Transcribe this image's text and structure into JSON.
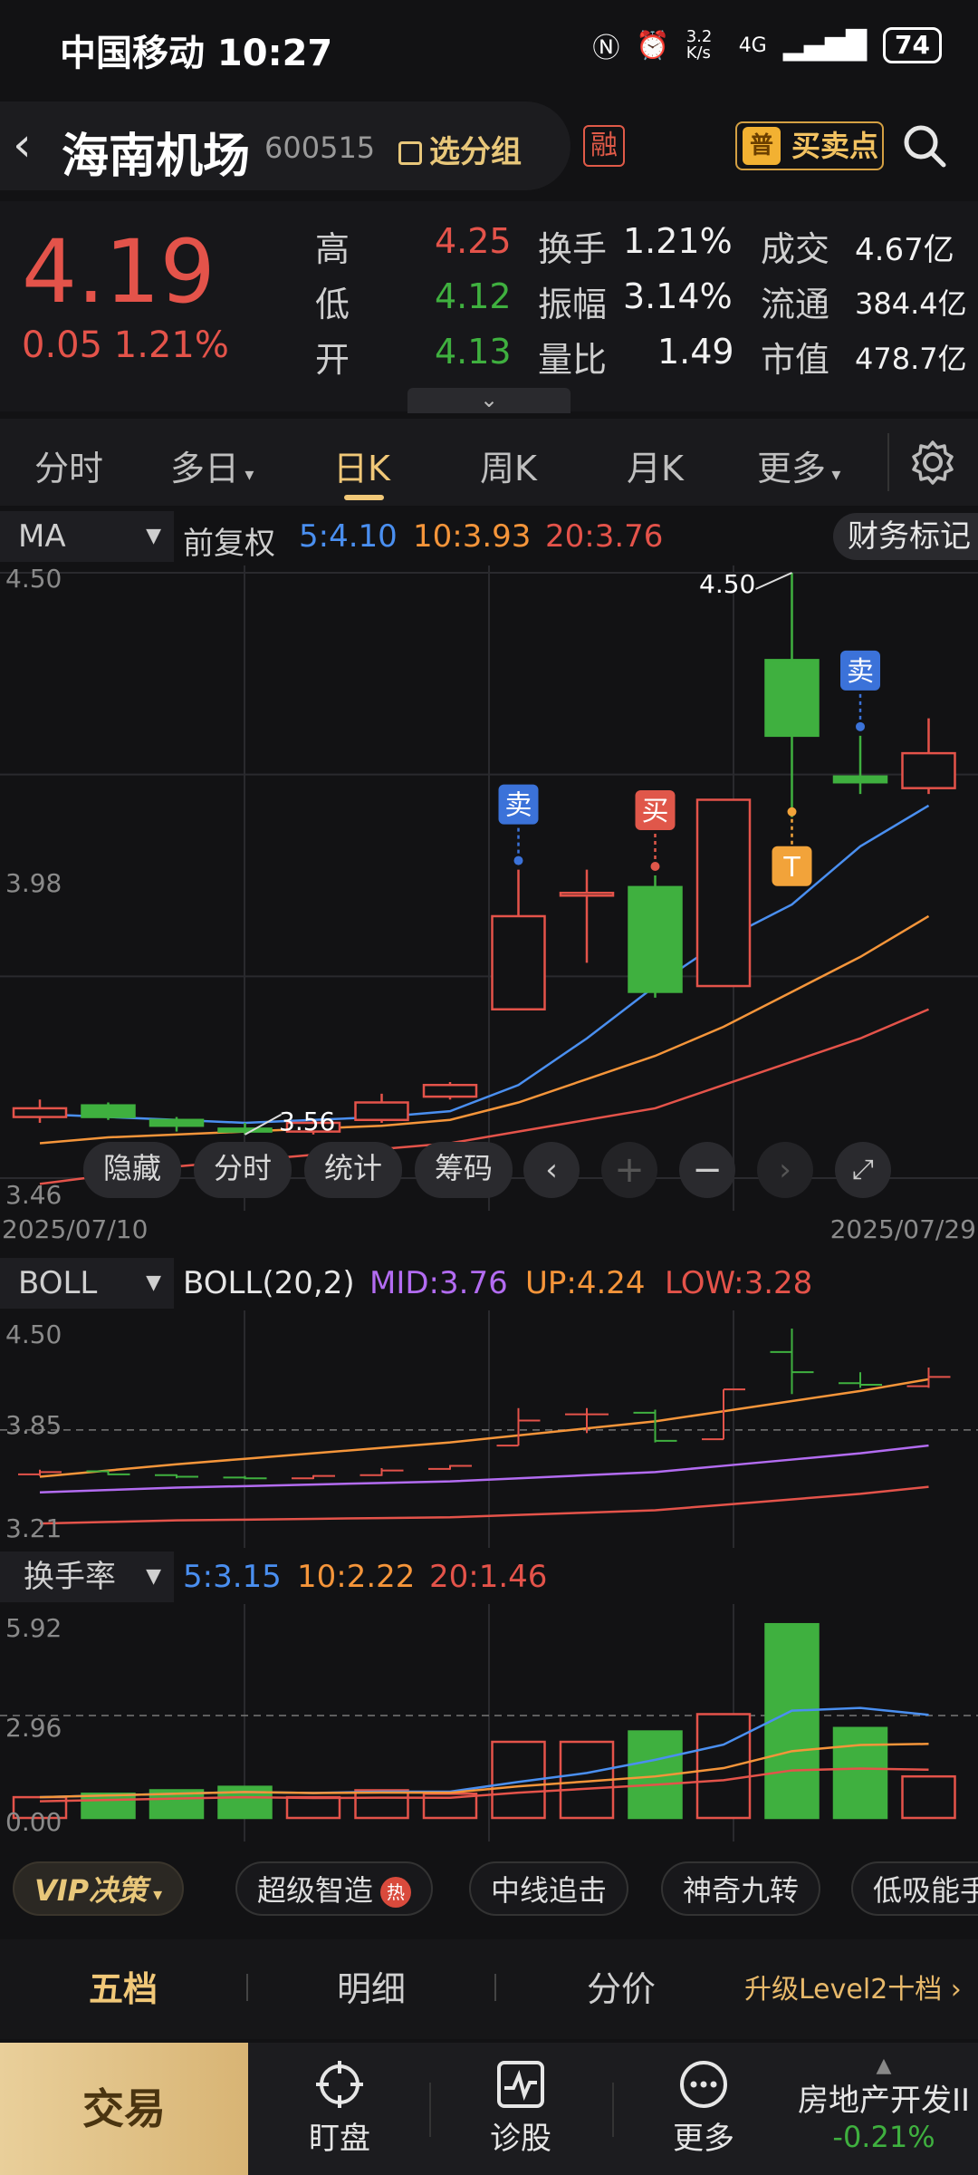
{
  "status": {
    "carrier_time": "中国移动 10:27",
    "speed": "3.2 K/s",
    "network": "4G",
    "battery": "74"
  },
  "header": {
    "back_glyph": "‹",
    "stock_name": "海南机场",
    "stock_code": "600515",
    "group_label": "选分组",
    "margin_badge": "融",
    "buy_sell_label": "买卖点",
    "buy_sell_badge": "普"
  },
  "quote": {
    "price": "4.19",
    "change": "0.05 1.21%",
    "high_label": "高",
    "high": "4.25",
    "low_label": "低",
    "low": "4.12",
    "open_label": "开",
    "open": "4.13",
    "turnover_label": "换手",
    "turnover": "1.21%",
    "amplitude_label": "振幅",
    "amplitude": "3.14%",
    "volume_ratio_label": "量比",
    "volume_ratio": "1.49",
    "deal_label": "成交",
    "deal": "4.67亿",
    "float_label": "流通",
    "float_cap": "384.4亿",
    "mcap_label": "市值",
    "mcap": "478.7亿"
  },
  "tabs": [
    {
      "label": "分时"
    },
    {
      "label": "多日"
    },
    {
      "label": "日K"
    },
    {
      "label": "周K"
    },
    {
      "label": "月K"
    },
    {
      "label": "更多"
    }
  ],
  "ma_bar": {
    "selector": "MA",
    "adjust": "前复权",
    "ma5": "5:4.10",
    "ma10": "10:3.93",
    "ma20": "20:3.76",
    "fin_mark": "财务标记"
  },
  "kchart": {
    "y_top": "4.50",
    "y_mid": "3.98",
    "y_bot": "3.46",
    "high_label": "4.50",
    "low_label": "3.56",
    "date_start": "2025/07/10",
    "date_end": "2025/07/29",
    "tool_hide": "隐藏",
    "tool_fenshi": "分时",
    "tool_stats": "统计",
    "tool_chip": "筹码",
    "sig_sell": "卖",
    "sig_buy": "买",
    "sig_t": "T"
  },
  "boll_bar": {
    "selector": "BOLL",
    "name": "BOLL(20,2)",
    "mid": "MID:3.76",
    "up": "UP:4.24",
    "low": "LOW:3.28",
    "y_top": "4.50",
    "y_mid": "3.85",
    "y_bot": "3.21"
  },
  "turn_bar": {
    "selector": "换手率",
    "ma5": "5:3.15",
    "ma10": "10:2.22",
    "ma20": "20:1.46",
    "y_top": "5.92",
    "y_mid": "2.96",
    "y_bot": "0.00"
  },
  "feature_chips": {
    "vip": "VIP决策",
    "c1": "超级智造",
    "hot": "热",
    "c2": "中线追击",
    "c3": "神奇九转",
    "c4": "低吸能手"
  },
  "bottom_tabs": {
    "t1": "五档",
    "t2": "明细",
    "t3": "分价",
    "upgrade": "升级Level2十档 ›"
  },
  "nav": {
    "trade": "交易",
    "watch": "盯盘",
    "diag": "诊股",
    "more": "更多",
    "sector": "房地产开发II",
    "sector_chg": "-0.21%"
  },
  "colors": {
    "up": "#e4534a",
    "down": "#3fb03f",
    "ma5": "#4a8ff0",
    "ma10": "#f5953a",
    "ma20": "#e4534a",
    "boll_mid": "#b36cf2",
    "gold": "#f1c878"
  },
  "chart_data": {
    "type": "candlestick",
    "candles": [
      {
        "open": 3.565,
        "close": 3.58,
        "high": 3.595,
        "low": 3.555
      },
      {
        "open": 3.585,
        "close": 3.565,
        "high": 3.59,
        "low": 3.56
      },
      {
        "open": 3.56,
        "close": 3.55,
        "high": 3.565,
        "low": 3.54
      },
      {
        "open": 3.545,
        "close": 3.54,
        "high": 3.555,
        "low": 3.535
      },
      {
        "open": 3.54,
        "close": 3.555,
        "high": 3.56,
        "low": 3.535
      },
      {
        "open": 3.56,
        "close": 3.59,
        "high": 3.605,
        "low": 3.555
      },
      {
        "open": 3.6,
        "close": 3.62,
        "high": 3.625,
        "low": 3.595
      },
      {
        "open": 3.75,
        "close": 3.91,
        "high": 3.99,
        "low": 3.75
      },
      {
        "open": 3.95,
        "close": 3.95,
        "high": 3.99,
        "low": 3.83
      },
      {
        "open": 3.96,
        "close": 3.78,
        "high": 3.98,
        "low": 3.77
      },
      {
        "open": 3.79,
        "close": 4.11,
        "high": 4.11,
        "low": 3.79
      },
      {
        "open": 4.35,
        "close": 4.22,
        "high": 4.5,
        "low": 4.08
      },
      {
        "open": 4.15,
        "close": 4.14,
        "high": 4.22,
        "low": 4.12
      },
      {
        "open": 4.13,
        "close": 4.19,
        "high": 4.25,
        "low": 4.12
      }
    ],
    "ma5": [
      3.57,
      3.565,
      3.56,
      3.555,
      3.56,
      3.565,
      3.575,
      3.62,
      3.7,
      3.79,
      3.87,
      3.93,
      4.03,
      4.1
    ],
    "ma10": [
      3.52,
      3.53,
      3.535,
      3.54,
      3.545,
      3.55,
      3.56,
      3.59,
      3.63,
      3.67,
      3.72,
      3.78,
      3.84,
      3.91
    ],
    "ma20": [
      3.45,
      3.465,
      3.48,
      3.49,
      3.5,
      3.51,
      3.52,
      3.54,
      3.56,
      3.58,
      3.62,
      3.66,
      3.7,
      3.75
    ],
    "ylim": [
      3.46,
      4.5
    ],
    "turnover": [
      0.6,
      0.7,
      0.8,
      0.9,
      0.6,
      0.8,
      0.7,
      2.2,
      2.2,
      2.5,
      3.0,
      5.6,
      2.6,
      1.2
    ],
    "turnover_ylim": [
      0,
      5.92
    ],
    "boll_ylim": [
      3.21,
      4.5
    ],
    "signals": [
      {
        "index": 7,
        "type": "卖"
      },
      {
        "index": 9,
        "type": "买"
      },
      {
        "index": 11,
        "type": "T"
      },
      {
        "index": 12,
        "type": "卖"
      }
    ]
  }
}
